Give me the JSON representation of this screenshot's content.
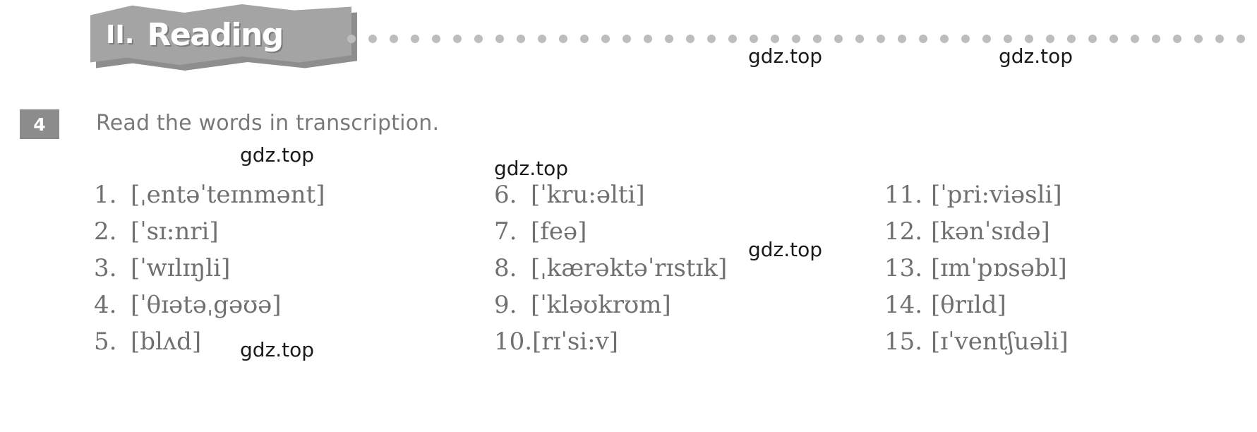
{
  "section": {
    "numeral": "II.",
    "title": "Reading",
    "dot_count": 46,
    "banner_color": "#a4a4a4",
    "banner_shadow_color": "#8e8e8e",
    "dot_color": "#bdbdbd"
  },
  "exercise": {
    "number": "4",
    "badge_color": "#8c8c8c",
    "instruction": "Read the words in transcription.",
    "instruction_color": "#78797b"
  },
  "transcriptions": {
    "text_color": "#6e7072",
    "columns": [
      {
        "items": [
          {
            "num": "1.",
            "ipa": "[ˌentəˈteɪnmənt]"
          },
          {
            "num": "2.",
            "ipa": "[ˈsɪ:nri]"
          },
          {
            "num": "3.",
            "ipa": "[ˈwɪlɪŋli]"
          },
          {
            "num": "4.",
            "ipa": "[ˈθɪətəˌgəʊə]"
          },
          {
            "num": "5.",
            "ipa": "[blʌd]"
          }
        ]
      },
      {
        "items": [
          {
            "num": "6.",
            "ipa": "[ˈkru:əlti]"
          },
          {
            "num": "7.",
            "ipa": "[feə]"
          },
          {
            "num": "8.",
            "ipa": "[ˌkærəktəˈrɪstɪk]"
          },
          {
            "num": "9.",
            "ipa": "[ˈkləʊkrʊm]"
          },
          {
            "num": "10.",
            "ipa": "[rɪˈsi:v]"
          }
        ]
      },
      {
        "items": [
          {
            "num": "11.",
            "ipa": "[ˈpri:viəsli]"
          },
          {
            "num": "12.",
            "ipa": "[kənˈsɪdə]"
          },
          {
            "num": "13.",
            "ipa": "[ɪmˈpɒsəbl]"
          },
          {
            "num": "14.",
            "ipa": "[θrɪld]"
          },
          {
            "num": "15.",
            "ipa": "[ɪˈventʃuəli]"
          }
        ]
      }
    ]
  },
  "watermarks": {
    "text": "gdz.top",
    "instances": [
      "gdz.top",
      "gdz.top",
      "gdz.top",
      "gdz.top",
      "gdz.top",
      "gdz.top"
    ]
  }
}
